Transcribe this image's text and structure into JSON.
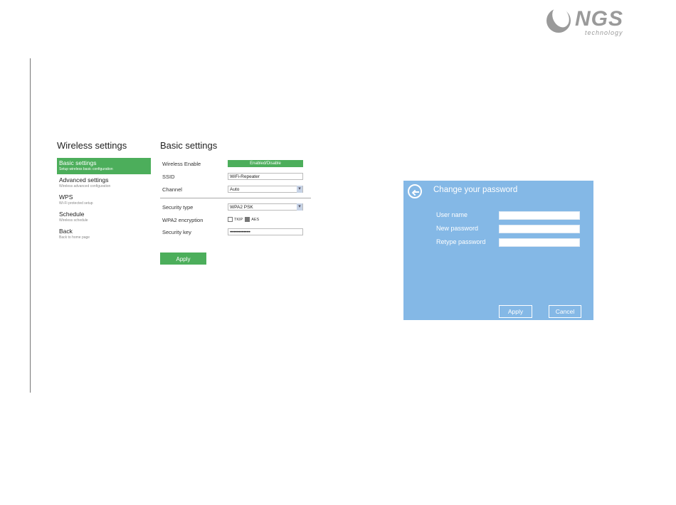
{
  "logo": {
    "word": "NGS",
    "sub": "technology"
  },
  "wireless": {
    "title": "Wireless settings",
    "menu": [
      {
        "label": "Basic settings",
        "desc": "Setup wireless basic configuration",
        "active": true
      },
      {
        "label": "Advanced settings",
        "desc": "Wireless advanced configuration",
        "active": false
      },
      {
        "label": "WPS",
        "desc": "Wi-Fi protected setup",
        "active": false
      },
      {
        "label": "Schedule",
        "desc": "Wireless schedule",
        "active": false
      },
      {
        "label": "Back",
        "desc": "Back to home page",
        "active": false
      }
    ]
  },
  "basic": {
    "title": "Basic settings",
    "wireless_enable_label": "Wireless Enable",
    "wireless_enable_value": "Enabled/Disable",
    "ssid_label": "SSID",
    "ssid_value": "WiFi-Repeater",
    "channel_label": "Channel",
    "channel_value": "Auto",
    "security_type_label": "Security type",
    "security_type_value": "WPA2 PSK",
    "wpa2_label": "WPA2 encryption",
    "tkip_label": "TKIP",
    "aes_label": "AES",
    "aes_checked": true,
    "security_key_label": "Security key",
    "security_key_value": "••••••••••••••••",
    "apply_label": "Apply"
  },
  "password_dialog": {
    "title": "Change your password",
    "username_label": "User name",
    "new_password_label": "New password",
    "retype_password_label": "Retype password",
    "apply_label": "Apply",
    "cancel_label": "Cancel"
  },
  "colors": {
    "green": "#4cae5b",
    "dialog_blue": "#84b8e6"
  }
}
